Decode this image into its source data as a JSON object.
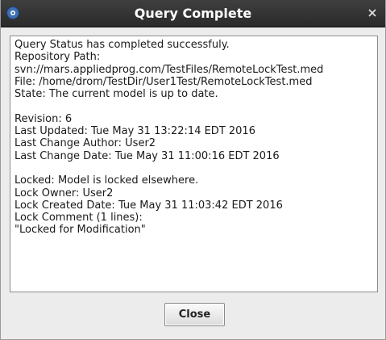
{
  "window": {
    "title": "Query Complete",
    "close_glyph": "×",
    "app_icon": "app-icon",
    "colors": {
      "titlebar": "#333333",
      "title_text": "#ffffff",
      "accent_icon": "#3d6fb5"
    }
  },
  "content": {
    "lines": [
      "Query Status has completed successfuly.",
      "Repository Path:",
      "svn://mars.appliedprog.com/TestFiles/RemoteLockTest.med",
      "File: /home/drom/TestDir/User1Test/RemoteLockTest.med",
      "State: The current model is up to date.",
      "",
      "Revision: 6",
      "Last Updated: Tue May 31 13:22:14 EDT 2016",
      "Last Change Author: User2",
      "Last Change Date: Tue May 31 11:00:16 EDT 2016",
      "",
      "Locked: Model is locked elsewhere.",
      "Lock Owner: User2",
      "Lock Created Date: Tue May 31 11:03:42 EDT 2016",
      "Lock Comment (1 lines):",
      "\"Locked for Modification\""
    ]
  },
  "buttons": {
    "close_label": "Close"
  }
}
